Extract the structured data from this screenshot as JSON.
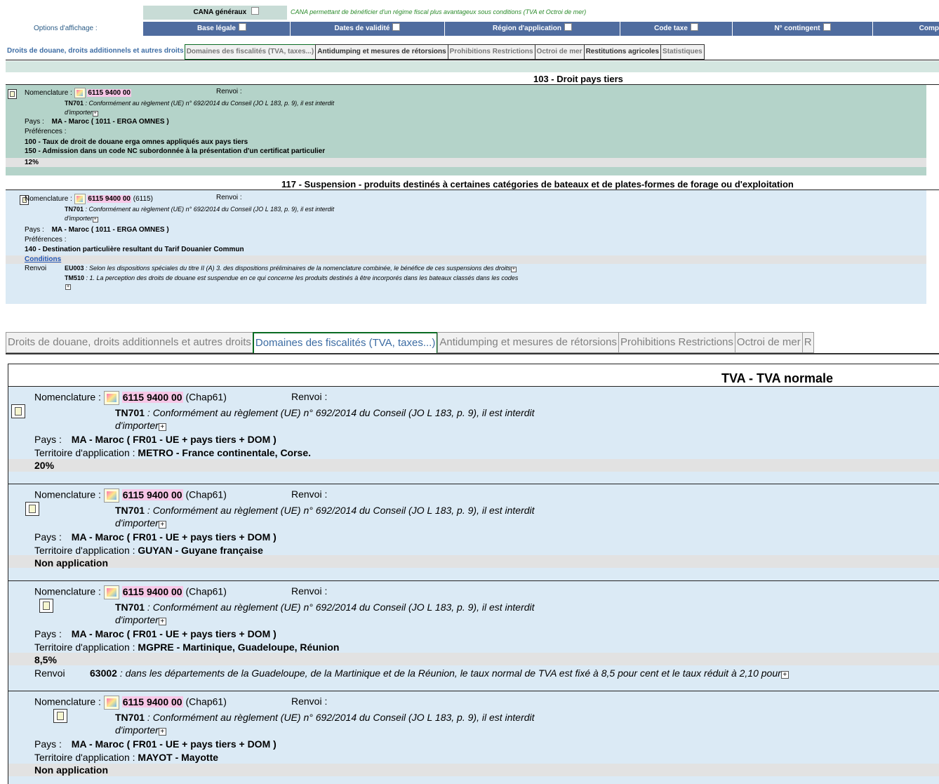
{
  "options": {
    "label": "Options d'affichage :",
    "cana_label": "CANA généraux",
    "cana_note": "CANA permettant de bénéficier d'un régime fiscal plus avantageux sous conditions (TVA et Octroi de mer)",
    "toggles": [
      "Base légale",
      "Dates de validité",
      "Région d'application",
      "Code taxe",
      "N° contingent",
      "Comp"
    ]
  },
  "tabs": [
    "Droits de douane, droits additionnels et autres droits",
    "Domaines des fiscalités (TVA, taxes...)",
    "Antidumping et mesures de rétorsions",
    "Prohibitions Restrictions",
    "Octroi de mer",
    "Restitutions agricoles",
    "Statistiques"
  ],
  "tabs_big": [
    "Droits de douane, droits additionnels et autres droits",
    "Domaines des fiscalités (TVA, taxes...)",
    "Antidumping et mesures de rétorsions",
    "Prohibitions Restrictions",
    "Octroi de mer",
    "R"
  ],
  "labels": {
    "nomenclature": "Nomenclature :",
    "renvoi_colon": "Renvoi :",
    "renvoi": "Renvoi",
    "pays": "Pays :",
    "preferences": "Préférences :",
    "territoire": "Territoire d'application :",
    "conditions": "Conditions",
    "plus": "+"
  },
  "tn701": {
    "code": "TN701",
    "text": ": Conformément au règlement (UE) n° 692/2014 du Conseil (JO L 183, p. 9), il est interdit",
    "text2": "d'importer"
  },
  "section1": {
    "title": "103 - Droit pays tiers",
    "code": "6115 9400 00",
    "pays": "MA - Maroc ( 1011 - ERGA OMNES )",
    "pref1": "100 - Taux de droit de douane erga omnes appliqués aux pays tiers",
    "pref2": "150 - Admission dans un code NC subordonnée à la présentation d'un certificat particulier",
    "rate": "12%"
  },
  "section2": {
    "title": "117 - Suspension - produits destinés à certaines catégories de bateaux et de plates-formes de forage ou d'exploitation",
    "code": "6115 9400 00",
    "chap": "(6115)",
    "pays": "MA - Maroc ( 1011 - ERGA OMNES )",
    "pref1": "140 - Destination particulière resultant du Tarif Douanier Commun",
    "r1code": "EU003",
    "r1text": ": Selon les dispositions spéciales du titre II (A) 3. des dispositions préliminaires de la nomenclature combinée, le bénéfice de ces suspensions des droits",
    "r2code": "TM510",
    "r2text": ": 1. La perception des droits de douane est suspendue en ce qui concerne les produits destinés à être incorporés dans les bateaux classés dans les codes"
  },
  "tva": {
    "title": "TVA - TVA normale",
    "code": "6115 9400 00",
    "chap": "(Chap61)",
    "pays": "MA - Maroc ( FR01 - UE + pays tiers + DOM )",
    "entries": [
      {
        "territoire": "METRO - France continentale, Corse.",
        "value": "20%"
      },
      {
        "territoire": "GUYAN - Guyane française",
        "value": "Non application"
      },
      {
        "territoire": "MGPRE - Martinique, Guadeloupe, Réunion",
        "value": "8,5%",
        "renvoi_code": "63002",
        "renvoi_text": ": dans les départements de la Guadeloupe, de la Martinique et de la Réunion, le taux normal de TVA est fixé à 8,5 pour cent et le taux réduit à 2,10 pour"
      },
      {
        "territoire": "MAYOT - Mayotte",
        "value": "Non application"
      }
    ]
  }
}
